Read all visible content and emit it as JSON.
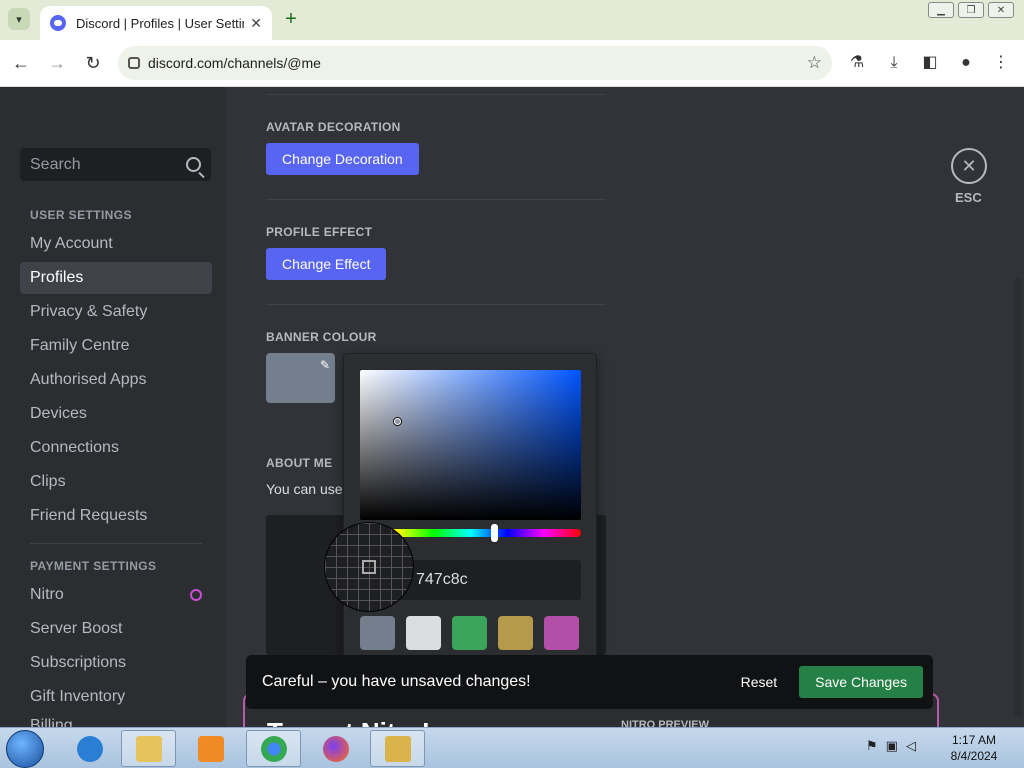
{
  "browser": {
    "tab_title": "Discord | Profiles | User Settings",
    "tab_close": "✕",
    "new_tab": "+",
    "url": "discord.com/channels/@me"
  },
  "sidebar": {
    "search_placeholder": "Search",
    "user_settings_header": "USER SETTINGS",
    "user_items": [
      "My Account",
      "Profiles",
      "Privacy & Safety",
      "Family Centre",
      "Authorised Apps",
      "Devices",
      "Connections",
      "Clips",
      "Friend Requests"
    ],
    "active_item": "Profiles",
    "payment_settings_header": "PAYMENT SETTINGS",
    "payment_items": [
      "Nitro",
      "Server Boost",
      "Subscriptions",
      "Gift Inventory"
    ],
    "peek_item": "Billing"
  },
  "content": {
    "avatar_decoration_label": "AVATAR DECORATION",
    "change_decoration_button": "Change Decoration",
    "profile_effect_label": "PROFILE EFFECT",
    "change_effect_button": "Change Effect",
    "banner_colour_label": "BANNER COLOUR",
    "about_me_label": "ABOUT ME",
    "about_me_text": "You can use"
  },
  "picker": {
    "hex_value": "747c8c",
    "presets": [
      "#747f8d",
      "#dcdde1",
      "#3ba55c",
      "#b59a4b",
      "#b34fa8"
    ]
  },
  "colors": {
    "banner": "#747f8d",
    "blurple": "#5865f2",
    "save_green": "#248046"
  },
  "esc": {
    "label": "ESC",
    "icon": "close-icon"
  },
  "unsaved": {
    "message": "Careful – you have unsaved changes!",
    "reset_label": "Reset",
    "save_label": "Save Changes"
  },
  "preview": {
    "title": "Try out Nitro!",
    "tag": "NITRO PREVIEW"
  },
  "taskbar": {
    "time": "1:17 AM",
    "date": "8/4/2024"
  }
}
